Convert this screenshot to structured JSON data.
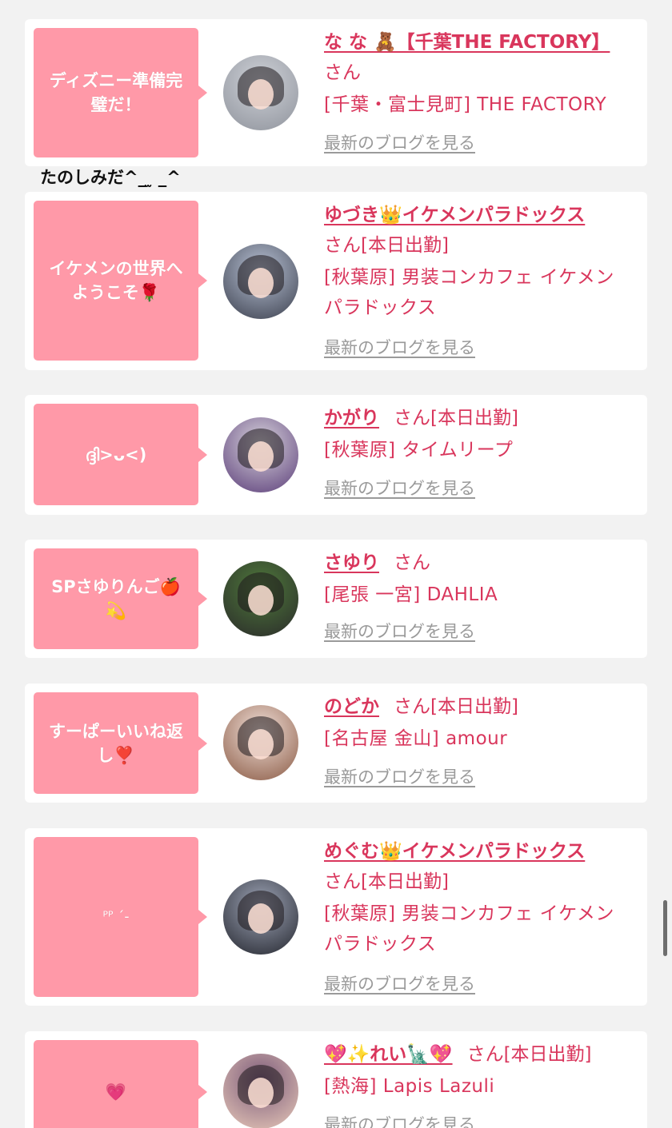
{
  "caption": "たのしみだ^_ ̫ _^",
  "entries": [
    {
      "message": "ディズニー準備完\n璧だ！",
      "name": "な な 🧸【千葉THE FACTORY】",
      "san": "さん",
      "shop": "[千葉・富士見町] THE FACTORY",
      "blog": "最新のブログを見る",
      "avatar_colors": [
        "#cfd2d8",
        "#8f939c"
      ]
    },
    {
      "message": "イケメンの世界へ\nようこそ🌹",
      "name": "ゆづき👑イケメンパラドックス",
      "san": "さん[本日出勤]",
      "shop": "[秋葉原] 男装コンカフェ イケメン\nパラドックス",
      "blog": "最新のブログを見る",
      "avatar_colors": [
        "#b9c3d6",
        "#3a3e4c"
      ]
    },
    {
      "message": "ദ്ദി>ᴗ<)",
      "name": "かがり",
      "san": "さん[本日出勤]",
      "shop": "[秋葉原] タイムリープ",
      "blog": "最新のブログを見る",
      "avatar_colors": [
        "#d8d4dc",
        "#5b3d79"
      ]
    },
    {
      "message": "SPさゆりんご🍎\n💫",
      "name": "さゆり",
      "san": "さん",
      "shop": "[尾張 一宮] DAHLIA",
      "blog": "最新のブログを見る",
      "avatar_colors": [
        "#4f7a3b",
        "#2a2a2a"
      ]
    },
    {
      "message": "すーぱーいいね返\nし❣️",
      "name": "のどか",
      "san": "さん[本日出勤]",
      "shop": "[名古屋 金山] amour",
      "blog": "最新のブログを見る",
      "avatar_colors": [
        "#f2e1da",
        "#8a5a44"
      ]
    },
    {
      "message": "ᴾᴾ ˊ-",
      "name": "めぐむ👑イケメンパラドックス",
      "san": "さん[本日出勤]",
      "shop": "[秋葉原] 男装コンカフェ イケメン\nパラドックス",
      "blog": "最新のブログを見る",
      "avatar_colors": [
        "#9fa6b8",
        "#23252d"
      ]
    },
    {
      "message": "💗",
      "name": "💖✨れい🗽💖",
      "san": "さん[本日出勤]",
      "shop": "[熱海] Lapis Lazuli",
      "blog": "最新のブログを見る",
      "avatar_colors": [
        "#7b5a7a",
        "#e8c9b8"
      ]
    }
  ]
}
